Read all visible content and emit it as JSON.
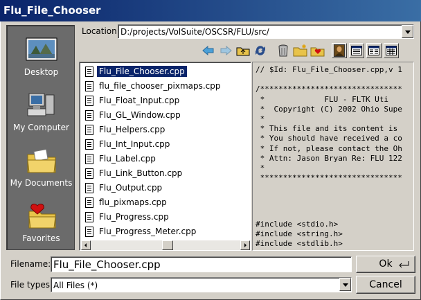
{
  "window": {
    "title": "Flu_File_Chooser"
  },
  "location": {
    "label": "Location:",
    "value": "D:/projects/VolSuite/OSCSR/FLU/src/"
  },
  "favorites": [
    {
      "label": "Desktop",
      "icon": "desktop-icon"
    },
    {
      "label": "My Computer",
      "icon": "computer-icon"
    },
    {
      "label": "My Documents",
      "icon": "documents-folder-icon"
    },
    {
      "label": "Favorites",
      "icon": "favorites-folder-icon"
    }
  ],
  "toolbar": {
    "icons": [
      "back-arrow-icon",
      "forward-arrow-icon",
      "up-folder-icon",
      "refresh-icon",
      "trash-icon",
      "new-folder-icon",
      "add-favorite-icon",
      "preview-icon",
      "list-view-icon",
      "detail-view-icon",
      "wide-view-icon"
    ]
  },
  "files": [
    "Flu_File_Chooser.cpp",
    "flu_file_chooser_pixmaps.cpp",
    "Flu_Float_Input.cpp",
    "Flu_GL_Window.cpp",
    "Flu_Helpers.cpp",
    "Flu_Int_Input.cpp",
    "Flu_Label.cpp",
    "Flu_Link_Button.cpp",
    "Flu_Output.cpp",
    "flu_pixmaps.cpp",
    "Flu_Progress.cpp",
    "Flu_Progress_Meter.cpp"
  ],
  "selected_file": "Flu_File_Chooser.cpp",
  "preview": {
    "lines_top": "// $Id: Flu_File_Chooser.cpp,v 1\n\n/*******************************\n *             FLU - FLTK Uti\n *  Copyright (C) 2002 Ohio Supe\n *\n * This file and its content is \n * You should have received a co\n * If not, please contact the Oh\n * Attn: Jason Bryan Re: FLU 122\n *\n *******************************",
    "lines_bottom": "#include <stdio.h>\n#include <string.h>\n#include <stdlib.h>"
  },
  "filename": {
    "label": "Filename:",
    "value": "Flu_File_Chooser.cpp"
  },
  "filetypes": {
    "label": "File types:",
    "value": "All Files (*)"
  },
  "buttons": {
    "ok": "Ok",
    "cancel": "Cancel"
  },
  "colors": {
    "title_bar": "#0a246a",
    "selection": "#0a246a",
    "sidebar": "#6b6b6b"
  }
}
